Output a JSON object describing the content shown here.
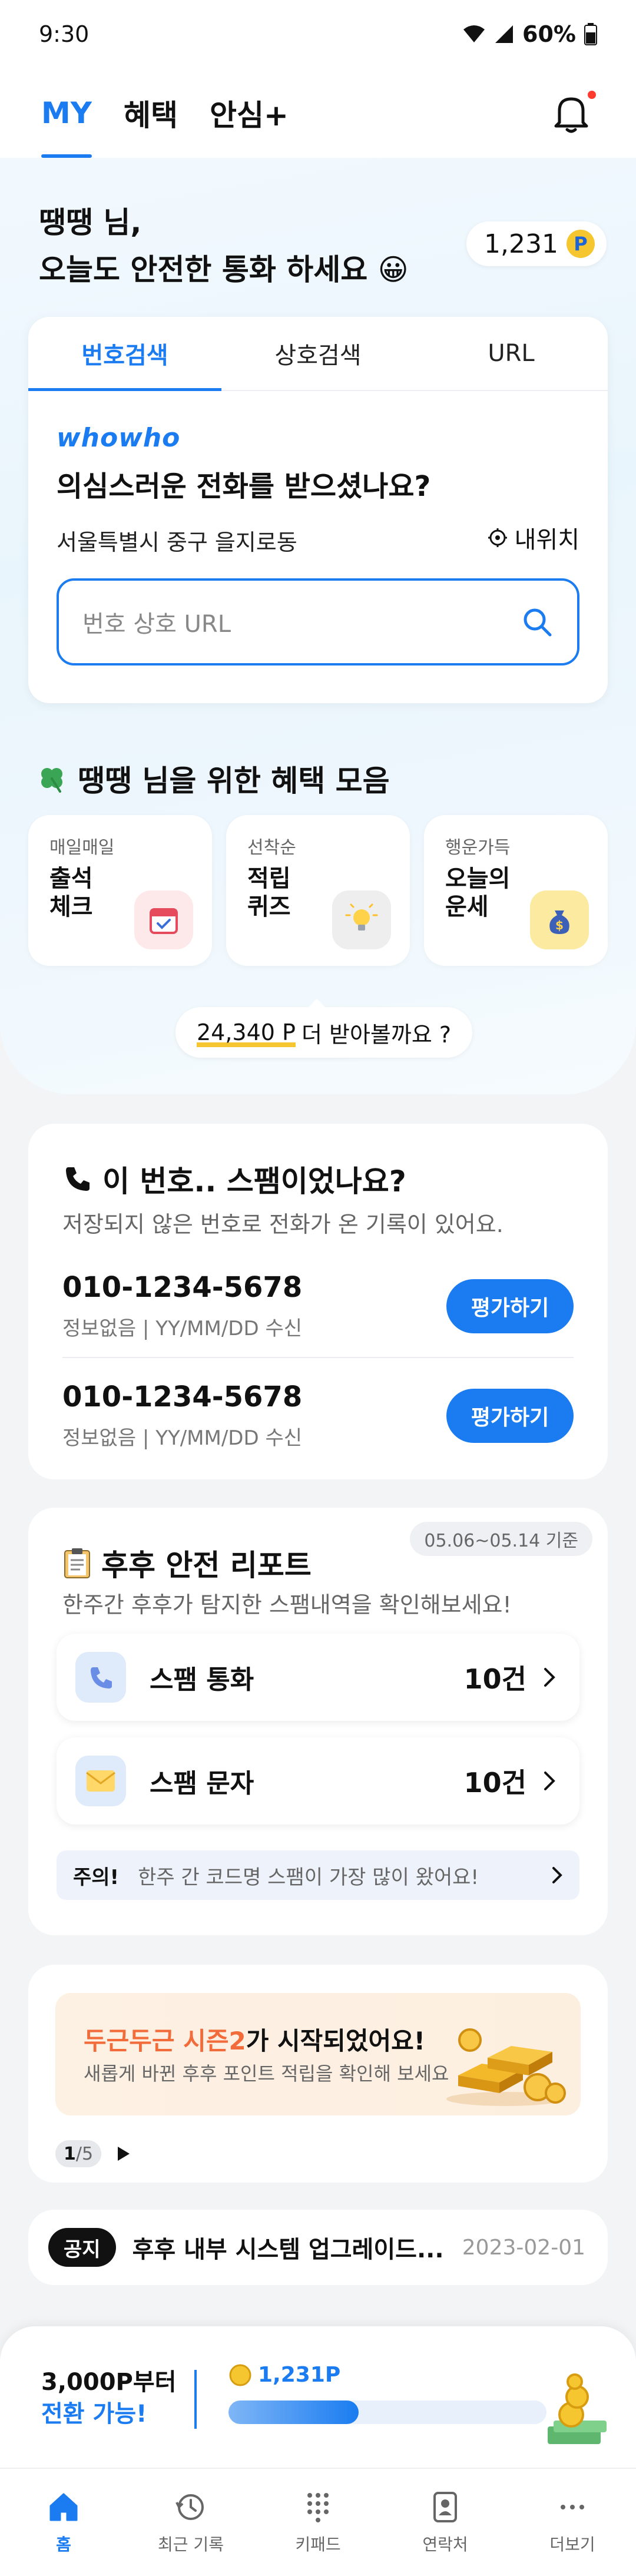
{
  "status_bar": {
    "time": "9:30",
    "battery": "60%"
  },
  "top_nav": {
    "tabs": [
      "MY",
      "혜택",
      "안심+"
    ],
    "active": 0
  },
  "hero": {
    "greeting_line1": "땡땡 님,",
    "greeting_line2": "오늘도 안전한 통화 하세요 😀",
    "points": "1,231",
    "points_badge": "P"
  },
  "search_card": {
    "tabs": [
      "번호검색",
      "상호검색",
      "URL"
    ],
    "logo_text": "whowho",
    "question": "의심스러운 전화를 받으셨나요?",
    "location": "서울특별시 중구 을지로동",
    "my_location_label": "내위치",
    "input_placeholder": "번호 상호 URL"
  },
  "benefits": {
    "title": "땡땡 님을 위한 혜택 모음",
    "cards": [
      {
        "small": "매일매일",
        "big1": "출석",
        "big2": "체크",
        "icon": "calendar-icon"
      },
      {
        "small": "선착순",
        "big1": "적립",
        "big2": "퀴즈",
        "icon": "lightbulb-icon"
      },
      {
        "small": "행운가득",
        "big1": "오늘의",
        "big2": "운세",
        "icon": "money-bag-icon"
      }
    ],
    "more_amount": "24,340 P",
    "more_text": "더 받아볼까요 ?"
  },
  "spam_check": {
    "title": "이 번호.. 스팸이었나요?",
    "subtitle": "저장되지 않은 번호로 전화가 온 기록이 있어요.",
    "rows": [
      {
        "number": "010-1234-5678",
        "meta": "정보없음  |  YY/MM/DD 수신",
        "button": "평가하기"
      },
      {
        "number": "010-1234-5678",
        "meta": "정보없음  |  YY/MM/DD 수신",
        "button": "평가하기"
      }
    ]
  },
  "report": {
    "title": "후후 안전 리포트",
    "subtitle": "한주간 후후가 탐지한 스팸내역을 확인해보세요!",
    "date_range": "05.06~05.14 기준",
    "rows": [
      {
        "label": "스팸 통화",
        "count": "10건",
        "icon": "phone-icon"
      },
      {
        "label": "스팸 문자",
        "count": "10건",
        "icon": "envelope-icon"
      }
    ],
    "warning_label": "주의!",
    "warning_text": "한주 간 코드명 스팸이 가장 많이 왔어요!"
  },
  "banner": {
    "title_highlight": "두근두근 시즌2",
    "title_rest": "가 시작되었어요!",
    "subtitle": "새롭게 바뀐 후후 포인트 적립을 확인해 보세요",
    "page_current": "1",
    "page_total": "/5"
  },
  "notice": {
    "badge": "공지",
    "text": "후후 내부 시스템 업그레이드...",
    "date": "2023-02-01"
  },
  "convert": {
    "line1": "3,000P부터",
    "line2": "전환 가능!",
    "points": "1,231P",
    "progress": 0.41
  },
  "bottom_nav": {
    "items": [
      {
        "label": "홈",
        "icon": "home-icon"
      },
      {
        "label": "최근 기록",
        "icon": "history-icon"
      },
      {
        "label": "키패드",
        "icon": "keypad-icon"
      },
      {
        "label": "연락처",
        "icon": "contacts-icon"
      },
      {
        "label": "더보기",
        "icon": "more-icon"
      }
    ],
    "active": 0
  },
  "colors": {
    "accent": "#1a7cf0",
    "coin": "#f6c630",
    "banner_highlight": "#f26b3a"
  }
}
